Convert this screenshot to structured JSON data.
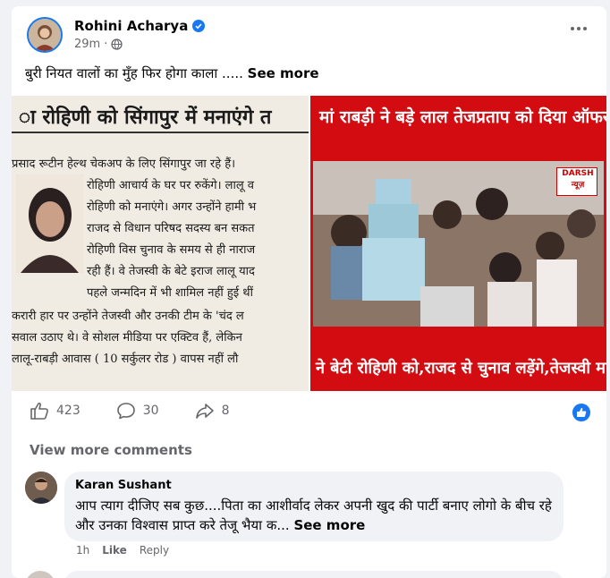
{
  "post": {
    "author": "Rohini Acharya",
    "time": "29m",
    "text": "बुरी नियत वालों का मुँह फिर होगा काला .....",
    "see_more": "See more"
  },
  "images": {
    "left_headline": "ा रोहिणी को सिंगापुर में मनाएंगे त",
    "left_lines": [
      "प्रसाद रूटीन हेल्थ चेकअप के लिए सिंगापुर जा रहे हैं।",
      "रोहिणी आचार्य के घर पर रुकेंगे। लालू व",
      "रोहिणी को मनाएंगे। अगर उन्होंने हामी भ",
      "राजद से विधान परिषद सदस्य बन सकत",
      "रोहिणी विस चुनाव के समय से ही नाराज",
      "रही हैं। वे तेजस्वी के बेटे इराज लालू याद",
      "पहले जन्मदिन में भी शामिल नहीं हुई थीं",
      "करारी हार पर उन्होंने तेजस्वी और उनकी टीम के 'चंद ल",
      "सवाल उठाए थे। वे सोशल मीडिया पर एक्टिव हैं, लेकिन",
      "लालू-राबड़ी आवास ( 10 सर्कुलर रोड ) वापस नहीं लौ"
    ],
    "right_top": "मां राबड़ी ने बड़े लाल तेजप्रताप को दिया ऑफर,लालू",
    "right_bottom": "ने बेटी रोहिणी को,राजद से चुनाव लड़ेंगे,तेजस्वी मान म्य..",
    "logo": "DARSH न्यूज़"
  },
  "stats": {
    "likes": "423",
    "comments": "30",
    "shares": "8"
  },
  "comments": {
    "view_more": "View more comments",
    "first": {
      "name": "Karan Sushant",
      "text": "आप त्याग दीजिए सब कुछ....पिता का आशीर्वाद लेकर अपनी खुद की पार्टी बनाए लोगो के बीच रहे और उनका विश्वास प्राप्त करे तेजू भैया क...",
      "see_more": "See more",
      "time": "1h",
      "like": "Like",
      "reply": "Reply"
    }
  },
  "colors": {
    "accent": "#1877f2",
    "news_red": "#d30c12"
  }
}
